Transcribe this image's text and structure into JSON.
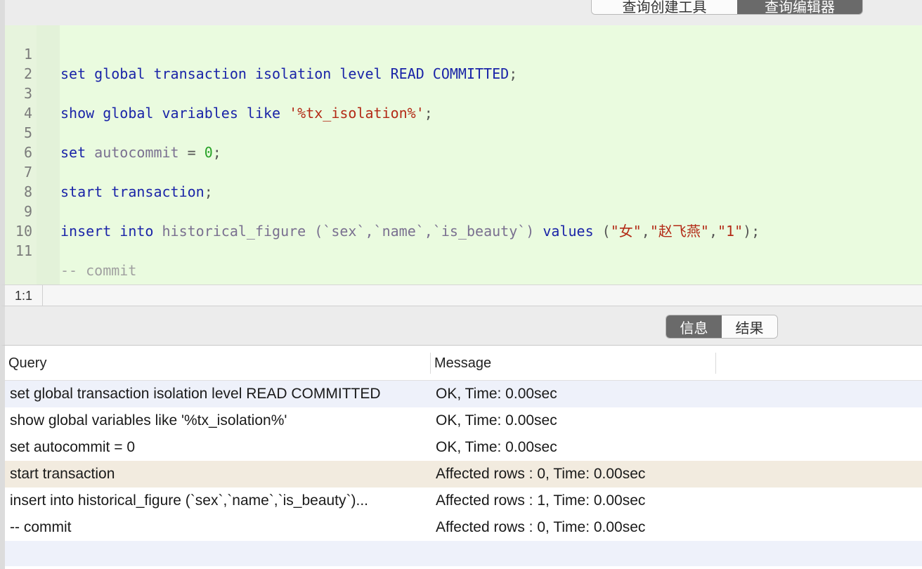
{
  "top_tabs": {
    "query_builder": "查询创建工具",
    "query_editor": "查询编辑器"
  },
  "editor": {
    "line_numbers": [
      "1",
      "2",
      "3",
      "4",
      "5",
      "6",
      "7",
      "8",
      "9",
      "10",
      "11"
    ],
    "lines": {
      "l1": {
        "kw1": "set global transaction isolation level READ COMMITTED",
        "p1": ";"
      },
      "l3": {
        "kw1": "show global variables like ",
        "str1": "'%tx_isolation%'",
        "p1": ";"
      },
      "l5": {
        "kw1": "set ",
        "id1": "autocommit",
        "p1": " = ",
        "num1": "0",
        "p2": ";"
      },
      "l7": {
        "kw1": "start transaction",
        "p1": ";"
      },
      "l9": {
        "kw1": "insert into ",
        "id1": "historical_figure",
        "p1": " (`sex`,`name`,`is_beauty`) ",
        "kw2": "values",
        "p2": " (",
        "str1": "\"女\"",
        "p3": ",",
        "str2": "\"赵飞燕\"",
        "p4": ",",
        "str3": "\"1\"",
        "p5": ");"
      },
      "l11": {
        "cmt1": "-- commit"
      }
    }
  },
  "status": {
    "cursor": "1:1"
  },
  "result_tabs": {
    "info": "信息",
    "result": "结果"
  },
  "table": {
    "headers": {
      "query": "Query",
      "message": "Message"
    },
    "rows": [
      {
        "query": "set global transaction isolation level READ COMMITTED",
        "message": "OK, Time: 0.00sec"
      },
      {
        "query": "show global variables like '%tx_isolation%'",
        "message": "OK, Time: 0.00sec"
      },
      {
        "query": "set autocommit = 0",
        "message": "OK, Time: 0.00sec"
      },
      {
        "query": "start transaction",
        "message": "Affected rows : 0, Time: 0.00sec"
      },
      {
        "query": "insert into historical_figure (`sex`,`name`,`is_beauty`)...",
        "message": "Affected rows : 1, Time: 0.00sec"
      },
      {
        "query": "-- commit",
        "message": "Affected rows : 0, Time: 0.00sec"
      }
    ]
  },
  "colors": {
    "editor_bg": "#eafbdf",
    "keyword": "#1a24a8",
    "string": "#b32a16",
    "number": "#27a227",
    "comment": "#a0a0a0",
    "active_tab": "#6a6a6a",
    "selected_row": "#f2ebdf",
    "alt_row": "#eef1fa"
  }
}
